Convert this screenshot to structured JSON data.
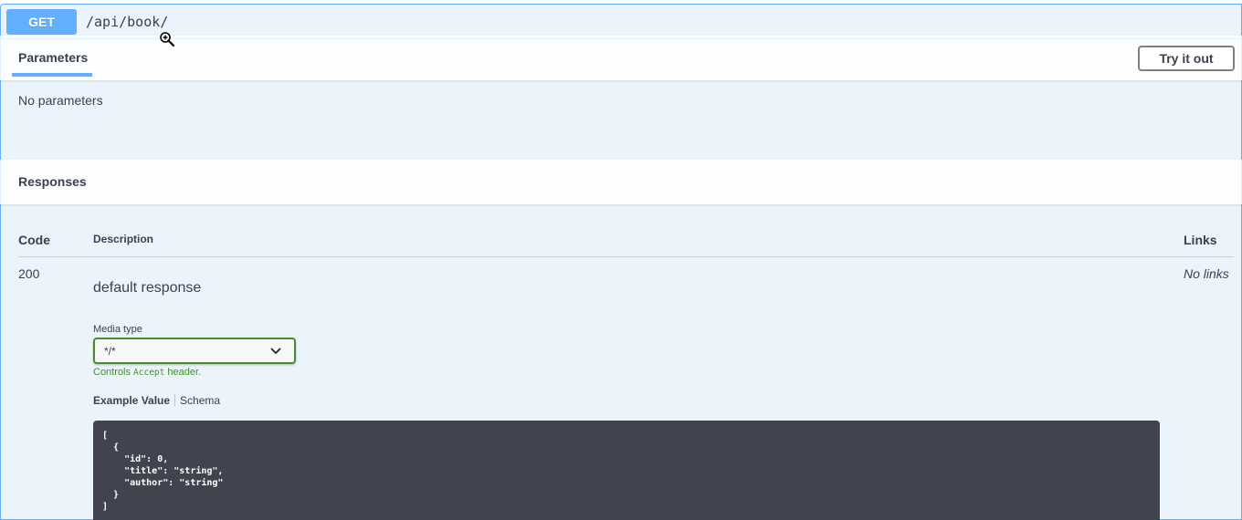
{
  "summary": {
    "method": "GET",
    "path": "/api/book/"
  },
  "parameters": {
    "tab_label": "Parameters",
    "try_button": "Try it out",
    "empty_text": "No parameters"
  },
  "responses": {
    "title": "Responses",
    "columns": {
      "code": "Code",
      "description": "Description",
      "links": "Links"
    },
    "rows": [
      {
        "code": "200",
        "description": "default response",
        "links": "No links",
        "media_type_label": "Media type",
        "media_type_value": "*/*",
        "controls_prefix": "Controls",
        "controls_code": "Accept",
        "controls_suffix": "header.",
        "tabs": [
          "Example Value",
          "Schema"
        ],
        "example": "[\n  {\n    \"id\": 0,\n    \"title\": \"string\",\n    \"author\": \"string\"\n  }\n]"
      }
    ]
  },
  "colors": {
    "get_accent": "#61affe",
    "opblock_bg": "#ebf3fb",
    "select_border": "#41902b",
    "code_bg": "#41444e"
  },
  "icons": {
    "cursor": "zoom-in-icon",
    "select_chevron": "chevron-down-icon"
  }
}
